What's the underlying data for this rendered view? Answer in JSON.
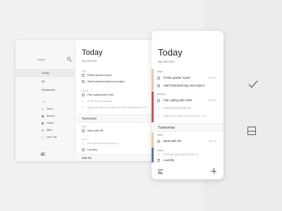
{
  "desktop": {
    "search": {
      "placeholder": "Search"
    },
    "nav": [
      {
        "label": "Today"
      },
      {
        "label": "All"
      },
      {
        "label": "Scheduled"
      }
    ],
    "lists_label": "List",
    "lists": [
      {
        "label": "Work",
        "color": "#e3cfa2"
      },
      {
        "label": "School",
        "color": "#c15d52"
      },
      {
        "label": "Home",
        "color": "#5b7aa2"
      },
      {
        "label": "Misc.",
        "color": "#bbbbbb"
      },
      {
        "label": "New List",
        "color": "#dddddd"
      }
    ],
    "title": "Today",
    "date": "Sep 20th 2018",
    "sections": {
      "work": "Work",
      "school": "School",
      "work2": "Work",
      "home": "Home"
    },
    "tasks": {
      "t1": "Finish quarter report",
      "t1_time": "4:30 PM",
      "t2": "Start brainstorming new project",
      "t3": "Pair coding with Chris",
      "t3_time": "4:30 PM",
      "t4": "Write thesis proposal",
      "t5": "Sign up for office hour with prof. Tom McWilliams for FP",
      "t6": "Meet with HR",
      "t6_time": "4:30 PM",
      "t7": "Pick up succulents from LJ",
      "t8": "Laundry"
    },
    "groups": {
      "tomorrow": "Tomorrow",
      "sat": "Sat 22"
    }
  },
  "mobile": {
    "title": "Today",
    "date": "Sep 20th 2018",
    "sections": {
      "work": "Work",
      "school": "School",
      "work2": "Work",
      "home": "Home"
    },
    "colors": {
      "work": "#e3cfa2",
      "school": "#c15d52",
      "home": "#5b7aa2"
    },
    "tasks": {
      "t1": "Finish quarter report",
      "t1_time": "4:30 PM",
      "t2": "Start brainstorming new project",
      "t3": "Pair coding with Chris",
      "t3_time": "4:30 PM",
      "t4": "Write thesis proposal",
      "t5": "Sign up for office hour with prof. Tom",
      "t6": "Meet with HR",
      "t6_time": "4:30 PM",
      "t7": "Pick up succulents from LJ",
      "t8": "Laundry"
    },
    "groups": {
      "tomorrow": "Tomorrow"
    }
  },
  "tools": {
    "check_icon": "check-icon",
    "layout_icon": "layout-icon"
  }
}
